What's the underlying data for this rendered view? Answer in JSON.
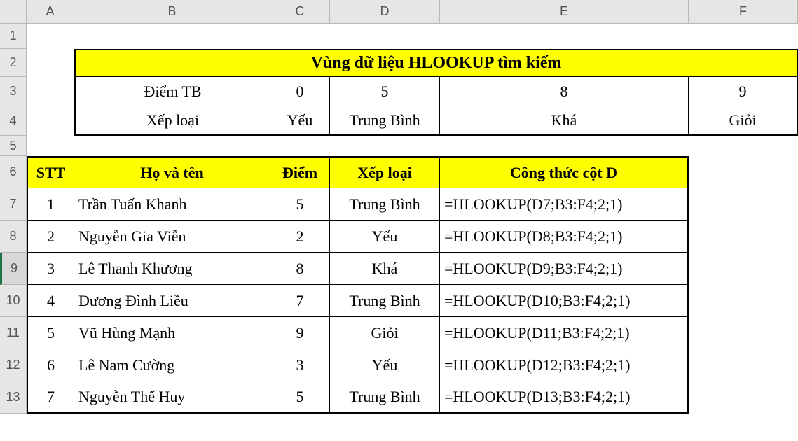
{
  "columns": [
    "A",
    "B",
    "C",
    "D",
    "E",
    "F"
  ],
  "rows": [
    "1",
    "2",
    "3",
    "4",
    "5",
    "6",
    "7",
    "8",
    "9",
    "10",
    "11",
    "12",
    "13"
  ],
  "selected_row": "9",
  "lookup": {
    "title": "Vùng dữ liệu HLOOKUP tìm kiếm",
    "row_labels": [
      "Điểm TB",
      "Xếp loại"
    ],
    "thresholds": [
      "0",
      "5",
      "8",
      "9"
    ],
    "grades": [
      "Yếu",
      "Trung Bình",
      "Khá",
      "Giỏi"
    ]
  },
  "headers": {
    "stt": "STT",
    "name": "Họ và tên",
    "score": "Điểm",
    "grade": "Xếp loại",
    "formula": "Công thức cột D"
  },
  "data": [
    {
      "stt": "1",
      "name": "Trần Tuấn Khanh",
      "score": "5",
      "grade": "Trung Bình",
      "formula": "=HLOOKUP(D7;B3:F4;2;1)"
    },
    {
      "stt": "2",
      "name": "Nguyễn Gia Viễn",
      "score": "2",
      "grade": "Yếu",
      "formula": "=HLOOKUP(D8;B3:F4;2;1)"
    },
    {
      "stt": "3",
      "name": "Lê Thanh Khương",
      "score": "8",
      "grade": "Khá",
      "formula": "=HLOOKUP(D9;B3:F4;2;1)"
    },
    {
      "stt": "4",
      "name": "Dương Đình Liều",
      "score": "7",
      "grade": "Trung Bình",
      "formula": "=HLOOKUP(D10;B3:F4;2;1)"
    },
    {
      "stt": "5",
      "name": "Vũ Hùng Mạnh",
      "score": "9",
      "grade": "Giỏi",
      "formula": "=HLOOKUP(D11;B3:F4;2;1)"
    },
    {
      "stt": "6",
      "name": "Lê Nam Cường",
      "score": "3",
      "grade": "Yếu",
      "formula": "=HLOOKUP(D12;B3:F4;2;1)"
    },
    {
      "stt": "7",
      "name": "Nguyễn Thế Huy",
      "score": "5",
      "grade": "Trung Bình",
      "formula": "=HLOOKUP(D13;B3:F4;2;1)"
    }
  ],
  "chart_data": {
    "type": "table",
    "title": "Vùng dữ liệu HLOOKUP tìm kiếm",
    "lookup_table": {
      "Điểm TB": [
        0,
        5,
        8,
        9
      ],
      "Xếp loại": [
        "Yếu",
        "Trung Bình",
        "Khá",
        "Giỏi"
      ]
    },
    "records": [
      {
        "STT": 1,
        "Họ và tên": "Trần Tuấn Khanh",
        "Điểm": 5,
        "Xếp loại": "Trung Bình",
        "Công thức cột D": "=HLOOKUP(D7;B3:F4;2;1)"
      },
      {
        "STT": 2,
        "Họ và tên": "Nguyễn Gia Viễn",
        "Điểm": 2,
        "Xếp loại": "Yếu",
        "Công thức cột D": "=HLOOKUP(D8;B3:F4;2;1)"
      },
      {
        "STT": 3,
        "Họ và tên": "Lê Thanh Khương",
        "Điểm": 8,
        "Xếp loại": "Khá",
        "Công thức cột D": "=HLOOKUP(D9;B3:F4;2;1)"
      },
      {
        "STT": 4,
        "Họ và tên": "Dương Đình Liều",
        "Điểm": 7,
        "Xếp loại": "Trung Bình",
        "Công thức cột D": "=HLOOKUP(D10;B3:F4;2;1)"
      },
      {
        "STT": 5,
        "Họ và tên": "Vũ Hùng Mạnh",
        "Điểm": 9,
        "Xếp loại": "Giỏi",
        "Công thức cột D": "=HLOOKUP(D11;B3:F4;2;1)"
      },
      {
        "STT": 6,
        "Họ và tên": "Lê Nam Cường",
        "Điểm": 3,
        "Xếp loại": "Yếu",
        "Công thức cột D": "=HLOOKUP(D12;B3:F4;2;1)"
      },
      {
        "STT": 7,
        "Họ và tên": "Nguyễn Thế Huy",
        "Điểm": 5,
        "Xếp loại": "Trung Bình",
        "Công thức cột D": "=HLOOKUP(D13;B3:F4;2;1)"
      }
    ]
  }
}
